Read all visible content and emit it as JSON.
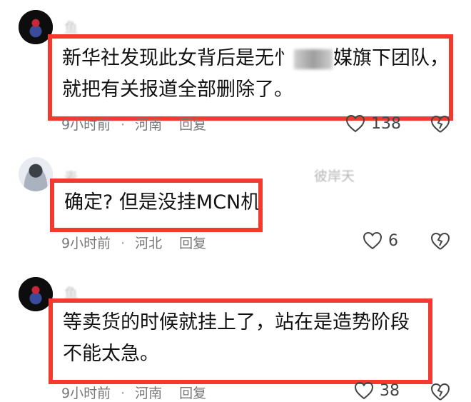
{
  "comments": [
    {
      "username": "鱼",
      "text_line1_a": "新华社发现此女背后是无忄",
      "text_line1_b": "媒旗下团队，",
      "text_line2": "就把有关报道全部删除了。",
      "time": "9小时前",
      "location": "河南",
      "reply": "回复",
      "likes": "138"
    },
    {
      "username": "麦",
      "username_tail": "彼岸天",
      "text": "确定? 但是没挂MCN机",
      "time": "9小时前",
      "location": "河北",
      "reply": "回复",
      "likes": "6"
    },
    {
      "username": "鱼",
      "text_line1": "等卖货的时候就挂上了，站在是造势阶段",
      "text_line2": "不能太急。",
      "time": "9小时前",
      "location": "河南",
      "reply": "回复",
      "likes": "38"
    }
  ],
  "colors": {
    "highlight_border": "#f23a2f",
    "meta_text": "#777777"
  },
  "icons": {
    "like": "heart-outline-icon",
    "dislike": "broken-heart-icon"
  }
}
